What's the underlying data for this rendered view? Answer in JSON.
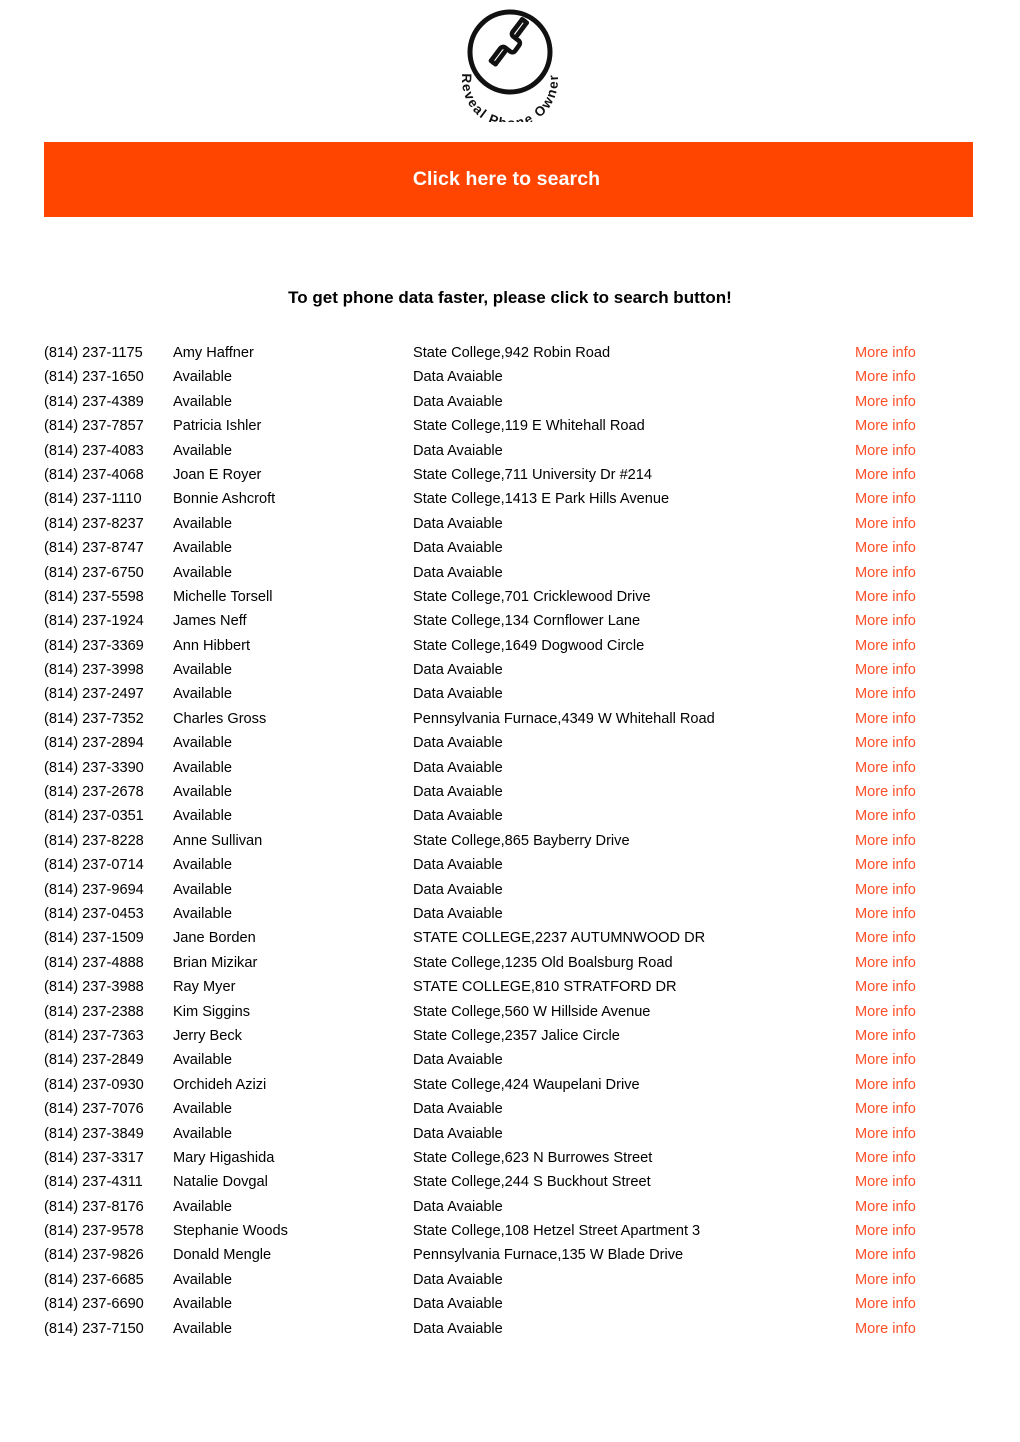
{
  "brand": {
    "logo_icon": "phone-handset-icon",
    "logo_text": "Reveal Phone Owner"
  },
  "banner": {
    "label": "Click here to search",
    "background_color": "#ff4500",
    "text_color": "#ffffff"
  },
  "heading": {
    "text": "To get phone data faster, please click to search button!"
  },
  "link_color": "#ff4f28",
  "results": {
    "more_info_label": "More info",
    "rows": [
      {
        "phone": "(814) 237-1175",
        "name": "Amy Haffner",
        "address": "State College,942 Robin Road"
      },
      {
        "phone": "(814) 237-1650",
        "name": "Available",
        "address": "Data Avaiable"
      },
      {
        "phone": "(814) 237-4389",
        "name": "Available",
        "address": "Data Avaiable"
      },
      {
        "phone": "(814) 237-7857",
        "name": "Patricia Ishler",
        "address": "State College,119 E Whitehall Road"
      },
      {
        "phone": "(814) 237-4083",
        "name": "Available",
        "address": "Data Avaiable"
      },
      {
        "phone": "(814) 237-4068",
        "name": "Joan E Royer",
        "address": "State College,711 University Dr #214"
      },
      {
        "phone": "(814) 237-1110",
        "name": "Bonnie Ashcroft",
        "address": "State College,1413 E Park Hills Avenue"
      },
      {
        "phone": "(814) 237-8237",
        "name": "Available",
        "address": "Data Avaiable"
      },
      {
        "phone": "(814) 237-8747",
        "name": "Available",
        "address": "Data Avaiable"
      },
      {
        "phone": "(814) 237-6750",
        "name": "Available",
        "address": "Data Avaiable"
      },
      {
        "phone": "(814) 237-5598",
        "name": "Michelle Torsell",
        "address": "State College,701 Cricklewood Drive"
      },
      {
        "phone": "(814) 237-1924",
        "name": "James Neff",
        "address": "State College,134 Cornflower Lane"
      },
      {
        "phone": "(814) 237-3369",
        "name": "Ann Hibbert",
        "address": "State College,1649 Dogwood Circle"
      },
      {
        "phone": "(814) 237-3998",
        "name": "Available",
        "address": "Data Avaiable"
      },
      {
        "phone": "(814) 237-2497",
        "name": "Available",
        "address": "Data Avaiable"
      },
      {
        "phone": "(814) 237-7352",
        "name": "Charles Gross",
        "address": "Pennsylvania Furnace,4349 W Whitehall Road"
      },
      {
        "phone": "(814) 237-2894",
        "name": "Available",
        "address": "Data Avaiable"
      },
      {
        "phone": "(814) 237-3390",
        "name": "Available",
        "address": "Data Avaiable"
      },
      {
        "phone": "(814) 237-2678",
        "name": "Available",
        "address": "Data Avaiable"
      },
      {
        "phone": "(814) 237-0351",
        "name": "Available",
        "address": "Data Avaiable"
      },
      {
        "phone": "(814) 237-8228",
        "name": "Anne Sullivan",
        "address": "State College,865 Bayberry Drive"
      },
      {
        "phone": "(814) 237-0714",
        "name": "Available",
        "address": "Data Avaiable"
      },
      {
        "phone": "(814) 237-9694",
        "name": "Available",
        "address": "Data Avaiable"
      },
      {
        "phone": "(814) 237-0453",
        "name": "Available",
        "address": "Data Avaiable"
      },
      {
        "phone": "(814) 237-1509",
        "name": "Jane Borden",
        "address": "STATE COLLEGE,2237 AUTUMNWOOD DR"
      },
      {
        "phone": "(814) 237-4888",
        "name": "Brian Mizikar",
        "address": "State College,1235 Old Boalsburg Road"
      },
      {
        "phone": "(814) 237-3988",
        "name": "Ray Myer",
        "address": "STATE COLLEGE,810 STRATFORD DR"
      },
      {
        "phone": "(814) 237-2388",
        "name": "Kim Siggins",
        "address": "State College,560 W Hillside Avenue"
      },
      {
        "phone": "(814) 237-7363",
        "name": "Jerry Beck",
        "address": "State College,2357 Jalice Circle"
      },
      {
        "phone": "(814) 237-2849",
        "name": "Available",
        "address": "Data Avaiable"
      },
      {
        "phone": "(814) 237-0930",
        "name": "Orchideh Azizi",
        "address": "State College,424 Waupelani Drive"
      },
      {
        "phone": "(814) 237-7076",
        "name": "Available",
        "address": "Data Avaiable"
      },
      {
        "phone": "(814) 237-3849",
        "name": "Available",
        "address": "Data Avaiable"
      },
      {
        "phone": "(814) 237-3317",
        "name": "Mary Higashida",
        "address": "State College,623 N Burrowes Street"
      },
      {
        "phone": "(814) 237-4311",
        "name": "Natalie Dovgal",
        "address": "State College,244 S Buckhout Street"
      },
      {
        "phone": "(814) 237-8176",
        "name": "Available",
        "address": "Data Avaiable"
      },
      {
        "phone": "(814) 237-9578",
        "name": "Stephanie Woods",
        "address": "State College,108 Hetzel Street Apartment 3"
      },
      {
        "phone": "(814) 237-9826",
        "name": "Donald Mengle",
        "address": "Pennsylvania Furnace,135 W Blade Drive"
      },
      {
        "phone": "(814) 237-6685",
        "name": "Available",
        "address": "Data Avaiable"
      },
      {
        "phone": "(814) 237-6690",
        "name": "Available",
        "address": "Data Avaiable"
      },
      {
        "phone": "(814) 237-7150",
        "name": "Available",
        "address": "Data Avaiable"
      }
    ]
  }
}
